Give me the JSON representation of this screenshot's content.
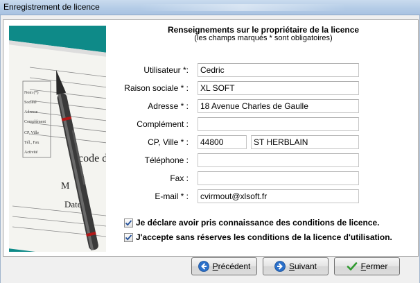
{
  "window": {
    "title": "Enregistrement de licence"
  },
  "form": {
    "heading": "Renseignements sur le propriétaire de la licence",
    "subheading": "(les champs marqués * sont obligatoires)",
    "fields": [
      {
        "label": "Utilisateur *:",
        "value": "Cedric"
      },
      {
        "label": "Raison sociale * :",
        "value": "XL SOFT"
      },
      {
        "label": "Adresse * :",
        "value": "18 Avenue Charles de Gaulle"
      },
      {
        "label": "Complément :",
        "value": ""
      },
      {
        "label": "CP, Ville * :",
        "value": "44800",
        "value2": "ST HERBLAIN"
      },
      {
        "label": "Téléphone :",
        "value": ""
      },
      {
        "label": "Fax :",
        "value": ""
      },
      {
        "label": "E-mail * :",
        "value": "cvirmout@xlsoft.fr"
      }
    ],
    "checkboxes": [
      {
        "label": "Je déclare avoir pris connaissance des conditions de licence.",
        "checked": true
      },
      {
        "label": "J'accepte sans réserves les conditions de la licence d'utilisation.",
        "checked": true
      }
    ]
  },
  "image": {
    "form_lines": [
      "Nom (*)",
      "Société",
      "Adresse",
      "Complément",
      "CP, Ville",
      "Tél., Fax",
      "Activité"
    ],
    "big_text": "code d",
    "big_text_2": "Date d",
    "letter_m": "M"
  },
  "buttons": {
    "previous": {
      "hotkey": "P",
      "rest": "récédent",
      "icon": "arrow-left-icon"
    },
    "next": {
      "hotkey": "S",
      "rest": "uivant",
      "icon": "arrow-right-icon"
    },
    "close": {
      "hotkey": "F",
      "rest": "ermer",
      "icon": "checkmark-icon"
    }
  },
  "colors": {
    "image_bg": "#0e8a88",
    "icon_blue": "#2a6fc9",
    "check_green": "#2f9a2f"
  }
}
